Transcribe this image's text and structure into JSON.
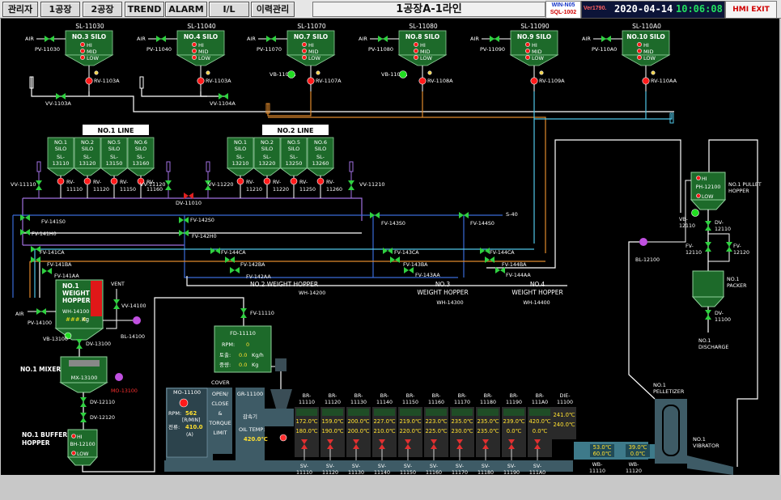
{
  "header": {
    "buttons": [
      "관리자",
      "1공장",
      "2공장",
      "TREND",
      "ALARM",
      "I/L",
      "이력관리"
    ],
    "title": "1공장A-1라인",
    "conn": [
      "WIN-N05",
      "SQL-1002"
    ],
    "version": "Ver1790.",
    "date": "2020-04-14",
    "time": "10:06:08",
    "exit": "HMI EXIT"
  },
  "top_silos": [
    {
      "tag": "SL-11030",
      "name": "NO.3 SILO",
      "air": "AIR",
      "pv": "PV-11030",
      "rv": "RV-1103A",
      "vv": "VV-1103A",
      "vb": ""
    },
    {
      "tag": "SL-11040",
      "name": "NO.4 SILO",
      "air": "AIR",
      "pv": "PV-11040",
      "rv": "RV-1103A",
      "vv": "VV-1104A",
      "vb": ""
    },
    {
      "tag": "SL-11070",
      "name": "NO.7 SILO",
      "air": "AIR",
      "pv": "PV-11070",
      "rv": "RV-1107A",
      "vv": "",
      "vb": "VB-1107A"
    },
    {
      "tag": "SL-11080",
      "name": "NO.8 SILO",
      "air": "AIR",
      "pv": "PV-11080",
      "rv": "RV-1108A",
      "vv": "",
      "vb": "VB-1108A"
    },
    {
      "tag": "SL-11090",
      "name": "NO.9 SILO",
      "air": "AIR",
      "pv": "PV-11090",
      "rv": "RV-1109A",
      "vv": "",
      "vb": ""
    },
    {
      "tag": "SL-110A0",
      "name": "NO.10 SILO",
      "air": "AIR",
      "pv": "PV-110A0",
      "rv": "RV-110AA",
      "vv": "",
      "vb": ""
    }
  ],
  "levels": [
    "HI",
    "MID",
    "LOW"
  ],
  "lines": {
    "line1": {
      "label": "NO.1 LINE",
      "silos": [
        {
          "name": "NO.1\nSILO",
          "tag": "SL-\n13110",
          "rv": "RV-\n11110"
        },
        {
          "name": "NO.2\nSILO",
          "tag": "SL-\n13120",
          "rv": "RV-\n11120"
        },
        {
          "name": "NO.5\nSILO",
          "tag": "SL-\n13150",
          "rv": "RV-\n11150"
        },
        {
          "name": "NO.6\nSILO",
          "tag": "SL-\n13160",
          "rv": "RV-\n11160"
        }
      ]
    },
    "line2": {
      "label": "NO.2 LINE",
      "silos": [
        {
          "name": "NO.1\nSILO",
          "tag": "SL-\n13210",
          "rv": "RV-\n11210"
        },
        {
          "name": "NO.2\nSILO",
          "tag": "SL-\n13220",
          "rv": "RV-\n11220"
        },
        {
          "name": "NO.5\nSILO",
          "tag": "SL-\n13250",
          "rv": "RV-\n11250"
        },
        {
          "name": "NO.6\nSILO",
          "tag": "SL-\n13260",
          "rv": "RV-\n11260"
        }
      ]
    }
  },
  "valves_mid": {
    "vv11110": "VV-11110",
    "vv11120": "VV-11120",
    "vv11220": "VV-11220",
    "vv11210": "VV-11210",
    "dv11010": "DV-11010",
    "s40": "S-40",
    "fv141s0": "FV-141S0",
    "fv141h0": "FV-141H0",
    "fv141ca": "FV-141CA",
    "fv141ba": "FV-141BA",
    "fv141aa": "FV-141AA",
    "fv142s0": "FV-142S0",
    "fv142h0": "FV-142H0",
    "fv144ca": "FV-144CA",
    "fv142ba": "FV-142BA",
    "fv142aa": "FV-142AA",
    "fv143s0": "FV-143S0",
    "fv144s0": "FV-144S0",
    "fv143ca": "FV-143CA",
    "fv143ba": "FV-143BA",
    "fv143aa": "FV-143AA",
    "fv144ca2": "FV-144CA",
    "fv144ba": "FV-144BA",
    "fv144aa": "FV-144AA"
  },
  "weight_hoppers": {
    "wh2": {
      "name": "NO.2 WEIGHT HOPPER",
      "tag": "WH-14200"
    },
    "wh3": {
      "name": "NO.3\nWEIGHT HOPPER",
      "tag": "WH-14300"
    },
    "wh4": {
      "name": "NO.4\nWEIGHT HOPPER",
      "tag": "WH-14400"
    }
  },
  "wh1": {
    "title": "NO.1\nWEIGHT\nHOPPER",
    "tag": "WH-14100",
    "value": "###.#",
    "unit": "Kg",
    "vent": "VENT",
    "vv": "VV-14100",
    "bl": "BL-14100",
    "air": "AIR",
    "pv": "PV-14100",
    "vb": "VB-13100",
    "dv": "DV-13100"
  },
  "mixer": {
    "label": "NO.1 MIXER",
    "tag": "MX-13100",
    "motor": "MO-13100",
    "dv1": "DV-12110",
    "dv2": "DV-12120"
  },
  "buffer": {
    "label": "NO.1 BUFFER\nHOPPER",
    "tag": "BH-12100",
    "hi": "HI",
    "low": "LOW"
  },
  "feeder": {
    "fv": "FV-11110",
    "tag": "FD-11110",
    "rpm_label": "RPM:",
    "rpm": "0",
    "row2_label": "토출:",
    "row2": "0.0",
    "row2_unit": "Kg/h",
    "row3_label": "중량:",
    "row3": "0.0",
    "row3_unit": "Kg"
  },
  "extruder": {
    "motor": "MO-11100",
    "rpm_label": "RPM:",
    "rpm": "562",
    "rpm_unit": "[R/MIN]",
    "cur_label": "전류:",
    "cur": "410.0",
    "cur_unit": "(A)",
    "cover": "COVER",
    "open": "OPEN/\nCLOSE\n&\nTORQUE\nLIMIT",
    "gr": "GR-11100",
    "gr_sub": "감속기",
    "oil": "OIL TEMP:",
    "oil_val": "420.0℃"
  },
  "barrels": [
    {
      "tag": "BR-\n11110",
      "set": "172.0℃",
      "act": "180.0℃",
      "sv": "SV-\n11110"
    },
    {
      "tag": "BR-\n11120",
      "set": "159.0℃",
      "act": "190.0℃",
      "sv": "SV-\n11120"
    },
    {
      "tag": "BR-\n11130",
      "set": "200.0℃",
      "act": "200.0℃",
      "sv": "SV-\n11130"
    },
    {
      "tag": "BR-\n11140",
      "set": "227.0℃",
      "act": "210.0℃",
      "sv": "SV-\n11140"
    },
    {
      "tag": "BR-\n11150",
      "set": "219.0℃",
      "act": "220.0℃",
      "sv": "SV-\n11150"
    },
    {
      "tag": "BR-\n11160",
      "set": "223.0℃",
      "act": "225.0℃",
      "sv": "SV-\n11160"
    },
    {
      "tag": "BR-\n11170",
      "set": "235.0℃",
      "act": "230.0℃",
      "sv": "SV-\n11170"
    },
    {
      "tag": "BR-\n11180",
      "set": "235.0℃",
      "act": "235.0℃",
      "sv": "SV-\n11180"
    },
    {
      "tag": "BR-\n11190",
      "set": "239.0℃",
      "act": "0.0℃",
      "sv": "SV-\n11190"
    },
    {
      "tag": "BR-\n111A0",
      "set": "420.0℃",
      "act": "0.0℃",
      "sv": "SV-\n111A0"
    }
  ],
  "die": {
    "tag": "DIE-\n11100",
    "set": "241.0℃",
    "act": "240.0℃"
  },
  "water_baths": [
    {
      "tag": "WB-\n11110",
      "v1": "53.0℃",
      "v2": "60.0℃"
    },
    {
      "tag": "WB-\n11120",
      "v1": "39.0℃",
      "v2": "0.0℃"
    }
  ],
  "pelletizer": {
    "label": "NO.1\nPELLETIZER",
    "vibrator": "NO.1\nVIBRATOR"
  },
  "right_side": {
    "ph": "PH-12100",
    "ph_hi": "HI",
    "ph_low": "LOW",
    "ph_label": "NO.1 PULLET\nHOPPER",
    "vb": "VB-\n12110",
    "dv1": "DV-\n12110",
    "fv1": "FV-\n12110",
    "fv2": "FV-\n12120",
    "packer": "NO.1\nPACKER",
    "dv2": "DV-\n11100",
    "discharge": "NO.1\nDISCHARGE",
    "bl": "BL-12100"
  },
  "colors": {
    "green_panel": "#1d6a2a",
    "pipe_white": "#ffffff",
    "pipe_orange": "#e08a2c",
    "pipe_cyan": "#4fc7e8",
    "pipe_blue": "#3a6bd8",
    "pipe_purple": "#a070e0",
    "valve_green": "#2fd040",
    "valve_red": "#e02020",
    "led_red": "#ff1a1a",
    "led_green": "#22dd22"
  }
}
